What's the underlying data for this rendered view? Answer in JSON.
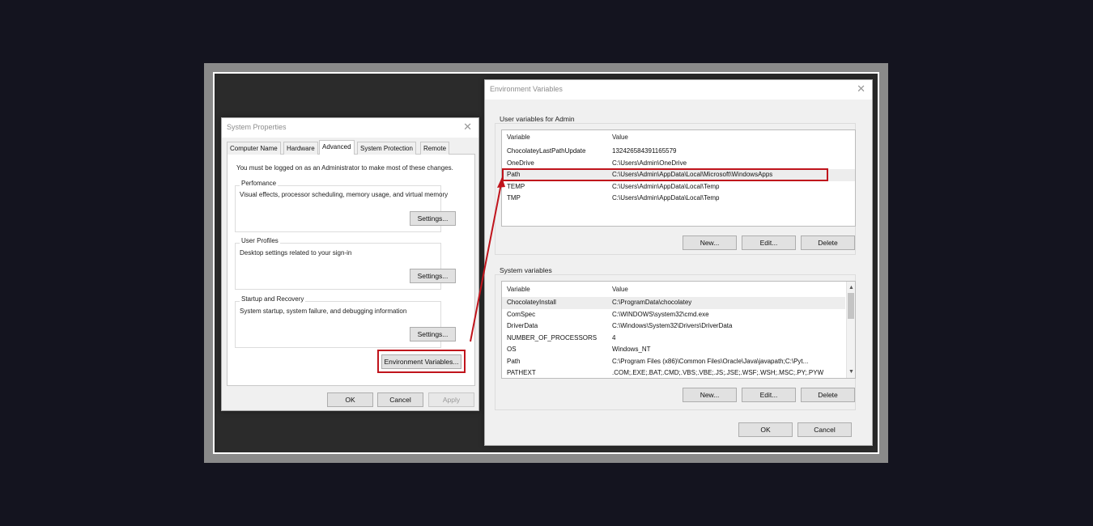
{
  "system_properties": {
    "title": "System Properties",
    "close": "✕",
    "tabs": [
      "Computer Name",
      "Hardware",
      "Advanced",
      "System Protection",
      "Remote"
    ],
    "note": "You must be logged on as an Administrator to make most of these changes.",
    "performance": {
      "title": "Perfomance",
      "desc": "Visual effects, processor scheduling, memory usage, and virtual memory",
      "button": "Settings..."
    },
    "user_profiles": {
      "title": "User Profiles",
      "desc": "Desktop settings related to your sign-in",
      "button": "Settings..."
    },
    "startup": {
      "title": "Startup and Recovery",
      "desc": "System startup, system failure, and debugging information",
      "button": "Settings..."
    },
    "env_button": "Environment Variables...",
    "ok": "OK",
    "cancel": "Cancel",
    "apply": "Apply"
  },
  "environment_variables": {
    "title": "Environment Variables",
    "close": "✕",
    "user_section": "User variables for Admin",
    "system_section": "System variables",
    "col_variable": "Variable",
    "col_value": "Value",
    "user_vars": [
      {
        "name": "ChocolateyLastPathUpdate",
        "value": "132426584391165579"
      },
      {
        "name": "OneDrive",
        "value": "C:\\Users\\Admin\\OneDrive"
      },
      {
        "name": "Path",
        "value": "C:\\Users\\Admin\\AppData\\Local\\Microsoft\\WindowsApps"
      },
      {
        "name": "TEMP",
        "value": "C:\\Users\\Admin\\AppData\\Local\\Temp"
      },
      {
        "name": "TMP",
        "value": "C:\\Users\\Admin\\AppData\\Local\\Temp"
      }
    ],
    "system_vars": [
      {
        "name": "ChocolateyInstall",
        "value": "C:\\ProgramData\\chocolatey"
      },
      {
        "name": "ComSpec",
        "value": "C:\\WINDOWS\\system32\\cmd.exe"
      },
      {
        "name": "DriverData",
        "value": "C:\\Windows\\System32\\Drivers\\DriverData"
      },
      {
        "name": "NUMBER_OF_PROCESSORS",
        "value": "4"
      },
      {
        "name": "OS",
        "value": "Windows_NT"
      },
      {
        "name": "Path",
        "value": "C:\\Program Files (x86)\\Common Files\\Oracle\\Java\\javapath;C:\\Pyt..."
      },
      {
        "name": "PATHEXT",
        "value": ".COM;.EXE;.BAT;.CMD;.VBS;.VBE;.JS;.JSE;.WSF;.WSH;.MSC;.PY;.PYW"
      }
    ],
    "new": "New...",
    "edit": "Edit...",
    "delete": "Delete",
    "ok": "OK",
    "cancel": "Cancel"
  },
  "colors": {
    "highlight": "#c0141c",
    "page_background": "#14141f",
    "frame": "#8a8a8a"
  }
}
